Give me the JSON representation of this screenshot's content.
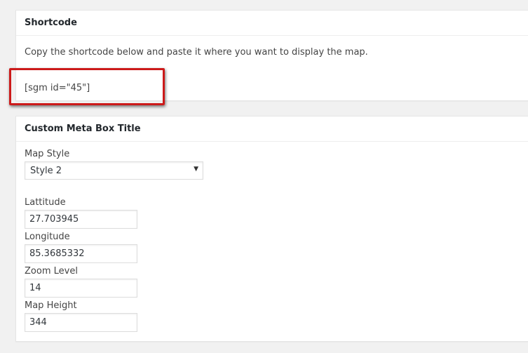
{
  "shortcode_box": {
    "title": "Shortcode",
    "description": "Copy the shortcode below and paste it where you want to display the map.",
    "shortcode": "[sgm id=\"45\"]"
  },
  "meta_box": {
    "title": "Custom Meta Box Title",
    "map_style": {
      "label": "Map Style",
      "value": "Style 2",
      "icon": "dropdown-arrow-icon"
    },
    "latitude": {
      "label": "Lattitude",
      "value": "27.703945"
    },
    "longitude": {
      "label": "Longitude",
      "value": "85.3685332"
    },
    "zoom_level": {
      "label": "Zoom Level",
      "value": "14"
    },
    "map_height": {
      "label": "Map Height",
      "value": "344"
    }
  },
  "colors": {
    "highlight": "#cc1a1a",
    "background": "#f1f1f1"
  }
}
